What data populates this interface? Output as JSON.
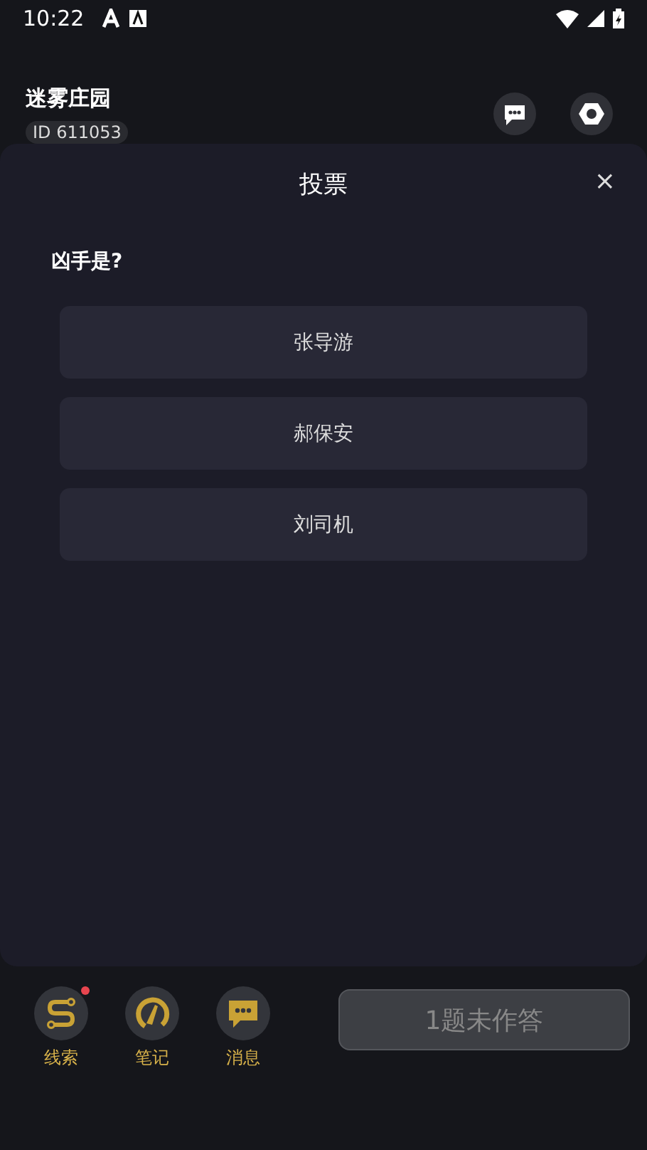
{
  "status_bar": {
    "time": "10:22"
  },
  "header": {
    "title": "迷雾庄园",
    "room_id": "ID 611053"
  },
  "dialog": {
    "title": "投票",
    "close": "×",
    "question": "凶手是?",
    "options": [
      {
        "label": "张导游"
      },
      {
        "label": "郝保安"
      },
      {
        "label": "刘司机"
      }
    ]
  },
  "bottom_nav": [
    {
      "kind": "clue",
      "label": "线索",
      "badge": true
    },
    {
      "kind": "note",
      "label": "笔记",
      "badge": false
    },
    {
      "kind": "message",
      "label": "消息",
      "badge": false
    }
  ],
  "submit_button": {
    "label": "1题未作答",
    "disabled": true
  }
}
